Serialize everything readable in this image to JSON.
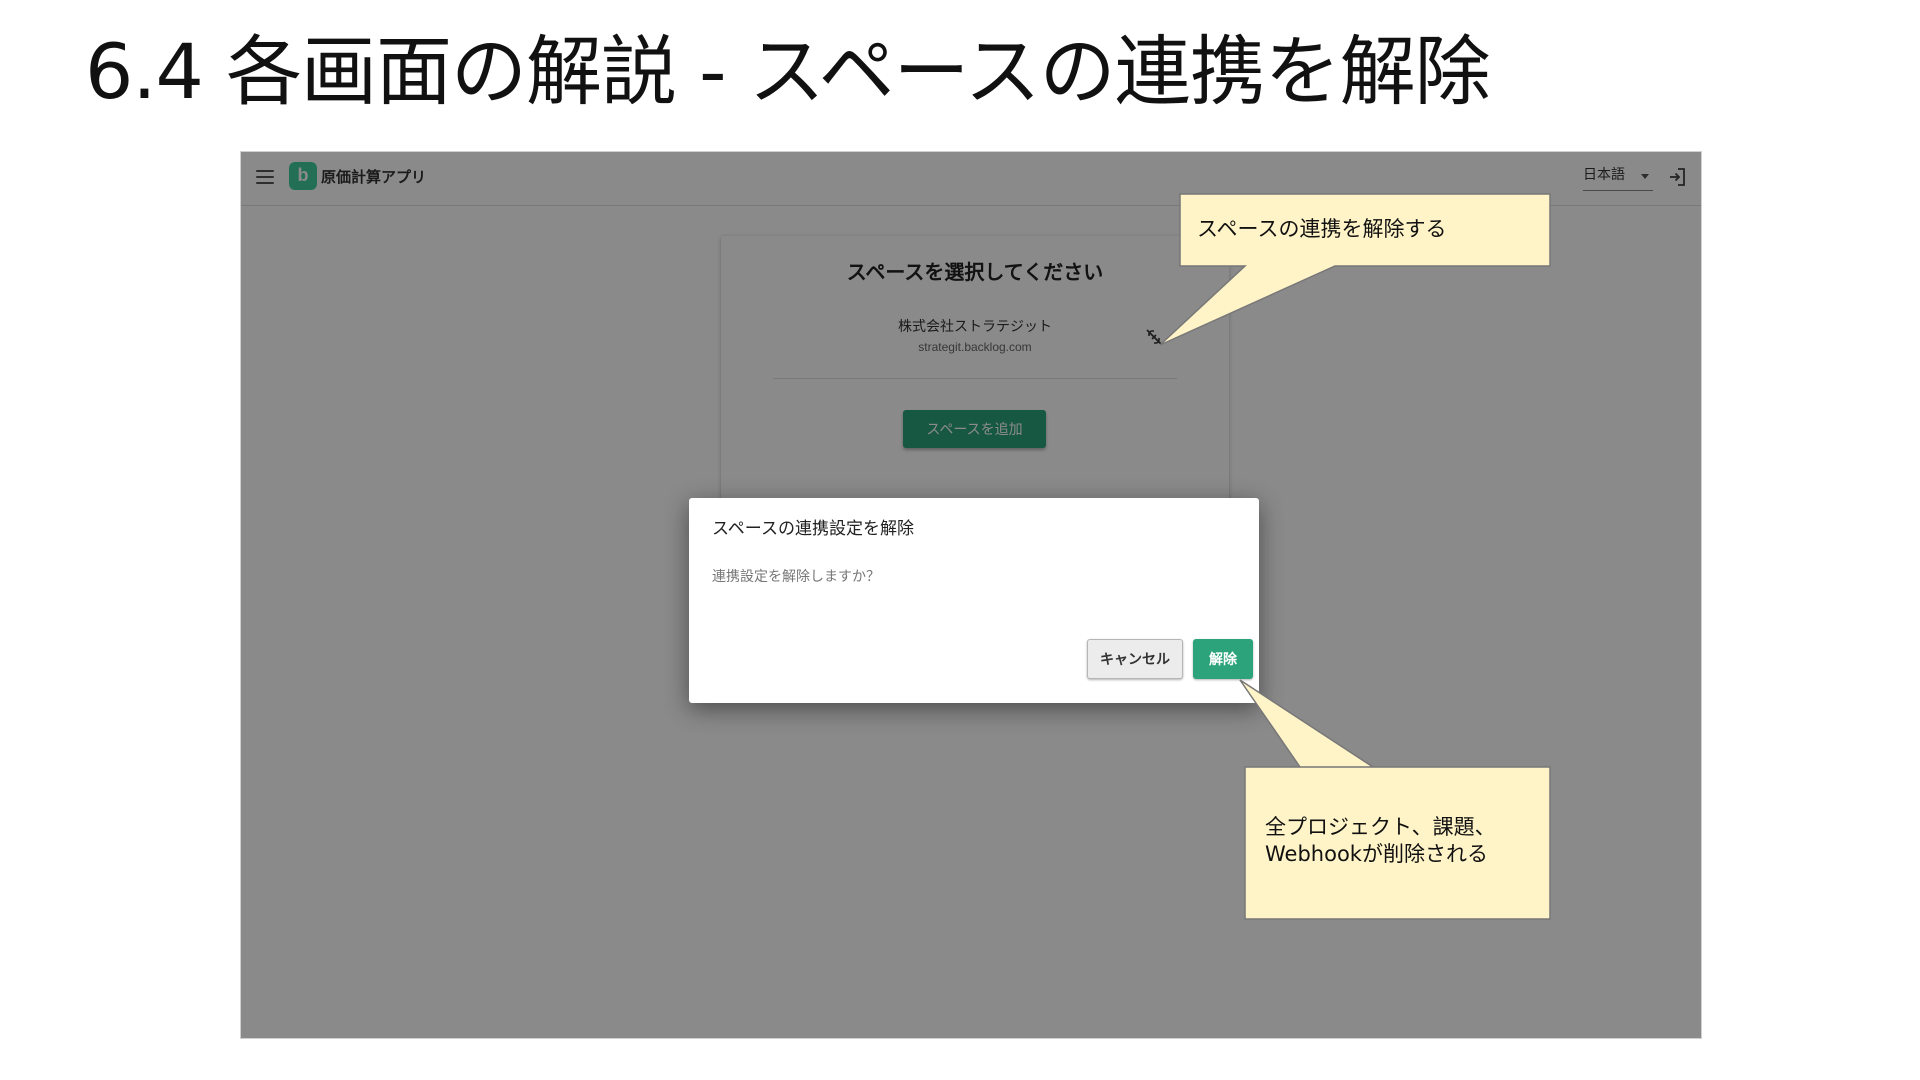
{
  "slide": {
    "title": "6.4 各画面の解説 - スペースの連携を解除"
  },
  "app": {
    "logo_letter": "b",
    "name": "原価計算アプリ",
    "language": "日本語"
  },
  "space_panel": {
    "title": "スペースを選択してください",
    "space_name": "株式会社ストラテジット",
    "space_url": "strategit.backlog.com",
    "add_button": "スペースを追加"
  },
  "dialog": {
    "title": "スペースの連携設定を解除",
    "message": "連携設定を解除しますか？",
    "cancel_label": "キャンセル",
    "confirm_label": "解除"
  },
  "callouts": {
    "unlink_note": "スペースの連携を解除する",
    "result_note_line1": "全プロジェクト、課題、",
    "result_note_line2": "Webhookが削除される"
  },
  "colors": {
    "brand_green": "#2ca37b",
    "logo_green": "#42ce9f",
    "callout_fill": "#fff4c8"
  }
}
